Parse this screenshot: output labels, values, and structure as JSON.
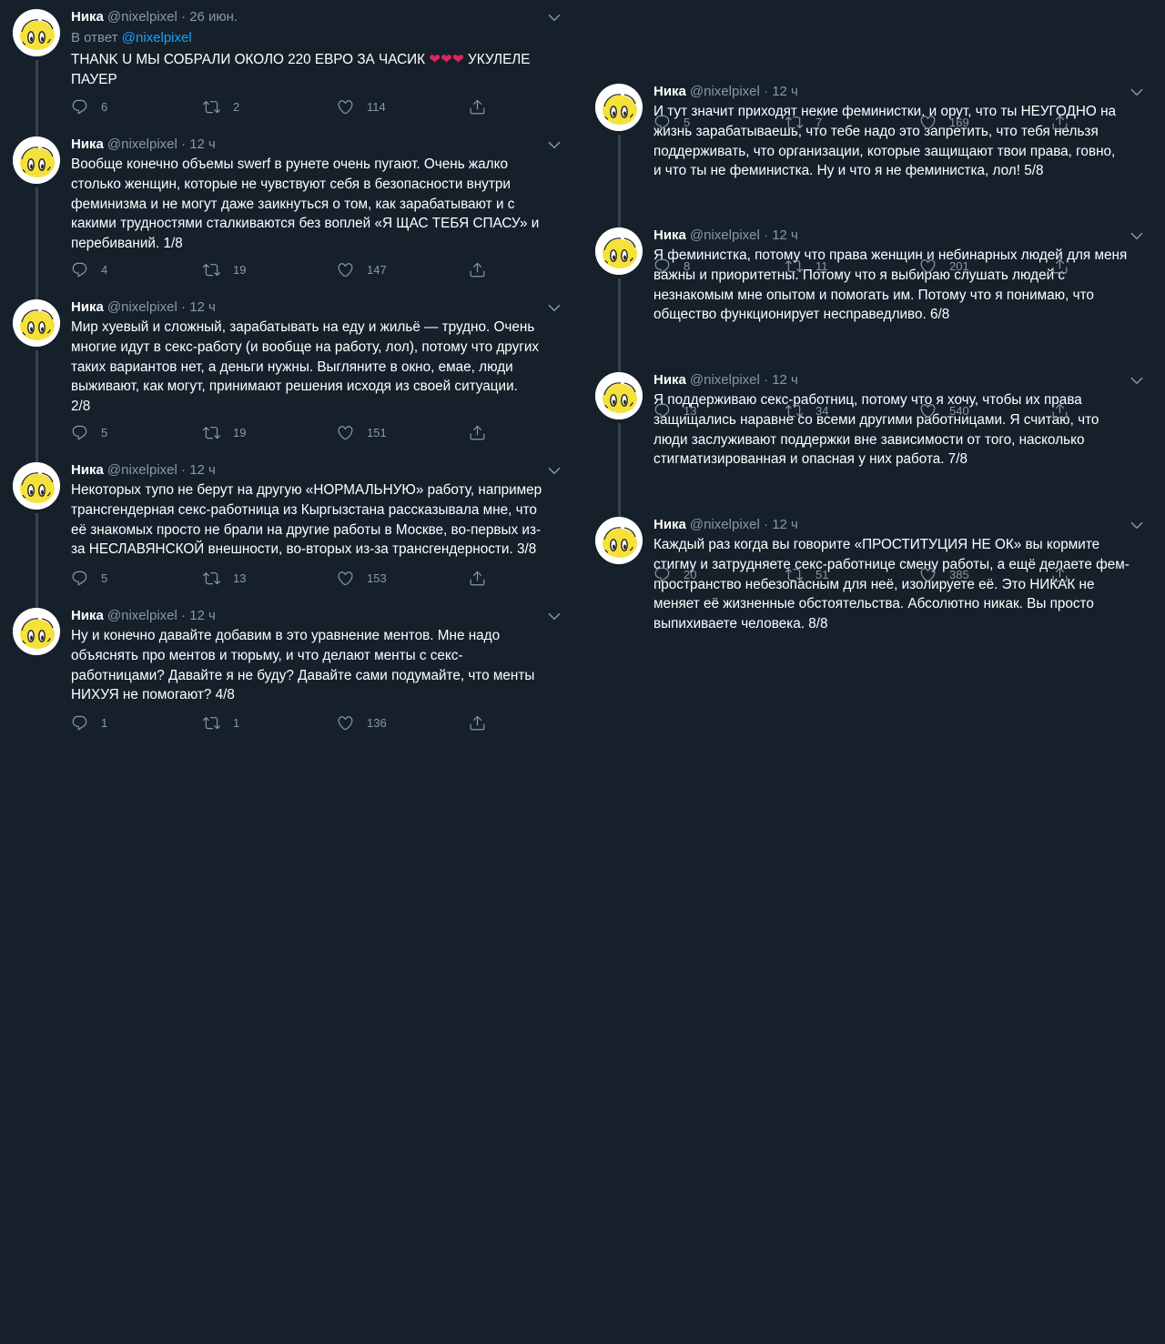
{
  "colors": {
    "background": "#15202b",
    "text": "#ffffff",
    "muted": "#8899a6",
    "link": "#1da1f2",
    "heart": "#e0245e"
  },
  "icons": {
    "reply": "reply-icon",
    "retweet": "retweet-icon",
    "like": "like-icon",
    "share": "share-icon",
    "more": "chevron-down-icon"
  },
  "columns": {
    "left": [
      {
        "name": "Ника",
        "handle": "@nixelpixel",
        "dot": "·",
        "time": "26 июн.",
        "reply_to": {
          "prefix": "В ответ",
          "user": "@nixelpixel"
        },
        "text": "THANK U МЫ СОБРАЛИ ОКОЛО 220 ЕВРО ЗА ЧАСИК ❤️❤️❤️ УКУЛЕЛЕ\nПАУЕР",
        "replies": "6",
        "retweets": "2",
        "likes": "114"
      },
      {
        "name": "Ника",
        "handle": "@nixelpixel",
        "dot": "·",
        "time": "12 ч",
        "text": "Вообще конечно объемы swerf в рунете очень пугают. Очень жалко\nстолько женщин, которые не чувствуют себя в безопасности внутри\nфеминизма и не могут даже заикнуться о том, как зарабатывают и с\nкакими трудностями сталкиваются без воплей «Я ЩАС ТЕБЯ СПАСУ» и\nперебиваний. 1/8",
        "replies": "4",
        "retweets": "19",
        "likes": "147"
      },
      {
        "name": "Ника",
        "handle": "@nixelpixel",
        "dot": "·",
        "time": "12 ч",
        "text": "Мир хуевый и сложный, зарабатывать на еду и жильё — трудно. Очень\nмногие идут в секс-работу (и вообще на работу, лол), потому что других\nтаких вариантов нет, а деньги нужны. Выгляните в окно, емае, люди\nвыживают, как могут, принимают решения исходя из своей ситуации.\n2/8",
        "replies": "5",
        "retweets": "19",
        "likes": "151"
      },
      {
        "name": "Ника",
        "handle": "@nixelpixel",
        "dot": "·",
        "time": "12 ч",
        "text": "Некоторых тупо не берут на другую «НОРМАЛЬНУЮ» работу, например\nтрансгендерная секс-работница из Кыргызстана рассказывала мне, что\nеё знакомых просто не брали на другие работы в Москве, во-первых из-\nза НЕСЛАВЯНСКОЙ внешности, во-вторых из-за трансгендерности. 3/8",
        "replies": "5",
        "retweets": "13",
        "likes": "153"
      },
      {
        "name": "Ника",
        "handle": "@nixelpixel",
        "dot": "·",
        "time": "12 ч",
        "text": "Ну и конечно давайте добавим в это уравнение ментов. Мне надо\nобъяснять про ментов и тюрьму, и что делают менты с секс-\nработницами? Давайте я не буду? Давайте сами подумайте, что менты\nНИХУЯ не помогают? 4/8",
        "replies": "1",
        "retweets": "1",
        "likes": "136"
      }
    ],
    "right": [
      {
        "name": "Ника",
        "handle": "@nixelpixel",
        "dot": "·",
        "time": "12 ч",
        "text": "И тут значит приходят некие феминистки, и орут, что ты НЕУГОДНО на\nжизнь зарабатываешь, что тебе надо это запретить, что тебя нельзя\nподдерживать, что организации, которые защищают твои права, говно,\nи что ты не феминистка. Ну и что я не феминистка, лол! 5/8",
        "replies": "5",
        "retweets": "7",
        "likes": "169"
      },
      {
        "name": "Ника",
        "handle": "@nixelpixel",
        "dot": "·",
        "time": "12 ч",
        "text": "Я феминистка, потому что права женщин и небинарных людей для меня\nважны и приоритетны. Потому что я выбираю слушать людей с\nнезнакомым мне опытом и помогать им. Потому что я понимаю, что\nобщество функционирует несправедливо. 6/8",
        "replies": "8",
        "retweets": "11",
        "likes": "201"
      },
      {
        "name": "Ника",
        "handle": "@nixelpixel",
        "dot": "·",
        "time": "12 ч",
        "text": "Я поддерживаю секс-работниц, потому что я хочу, чтобы их права\nзащищались наравне со всеми другими работницами. Я считаю, что\nлюди заслуживают поддержки вне зависимости от того, насколько\nстигматизированная и опасная у них работа. 7/8",
        "replies": "13",
        "retweets": "34",
        "likes": "540"
      },
      {
        "name": "Ника",
        "handle": "@nixelpixel",
        "dot": "·",
        "time": "12 ч",
        "text": "Каждый раз когда вы говорите «ПРОСТИТУЦИЯ НЕ ОК» вы кормите\nстигму и затрудняете секс-работнице смену работы, а ещё  делаете фем-\nпространство небезопасным для неё, изолируете её. Это НИКАК не\nменяет её жизненные обстоятельства. Абсолютно никак. Вы просто\nвыпихиваете человека. 8/8",
        "replies": "20",
        "retweets": "51",
        "likes": "385"
      }
    ]
  }
}
